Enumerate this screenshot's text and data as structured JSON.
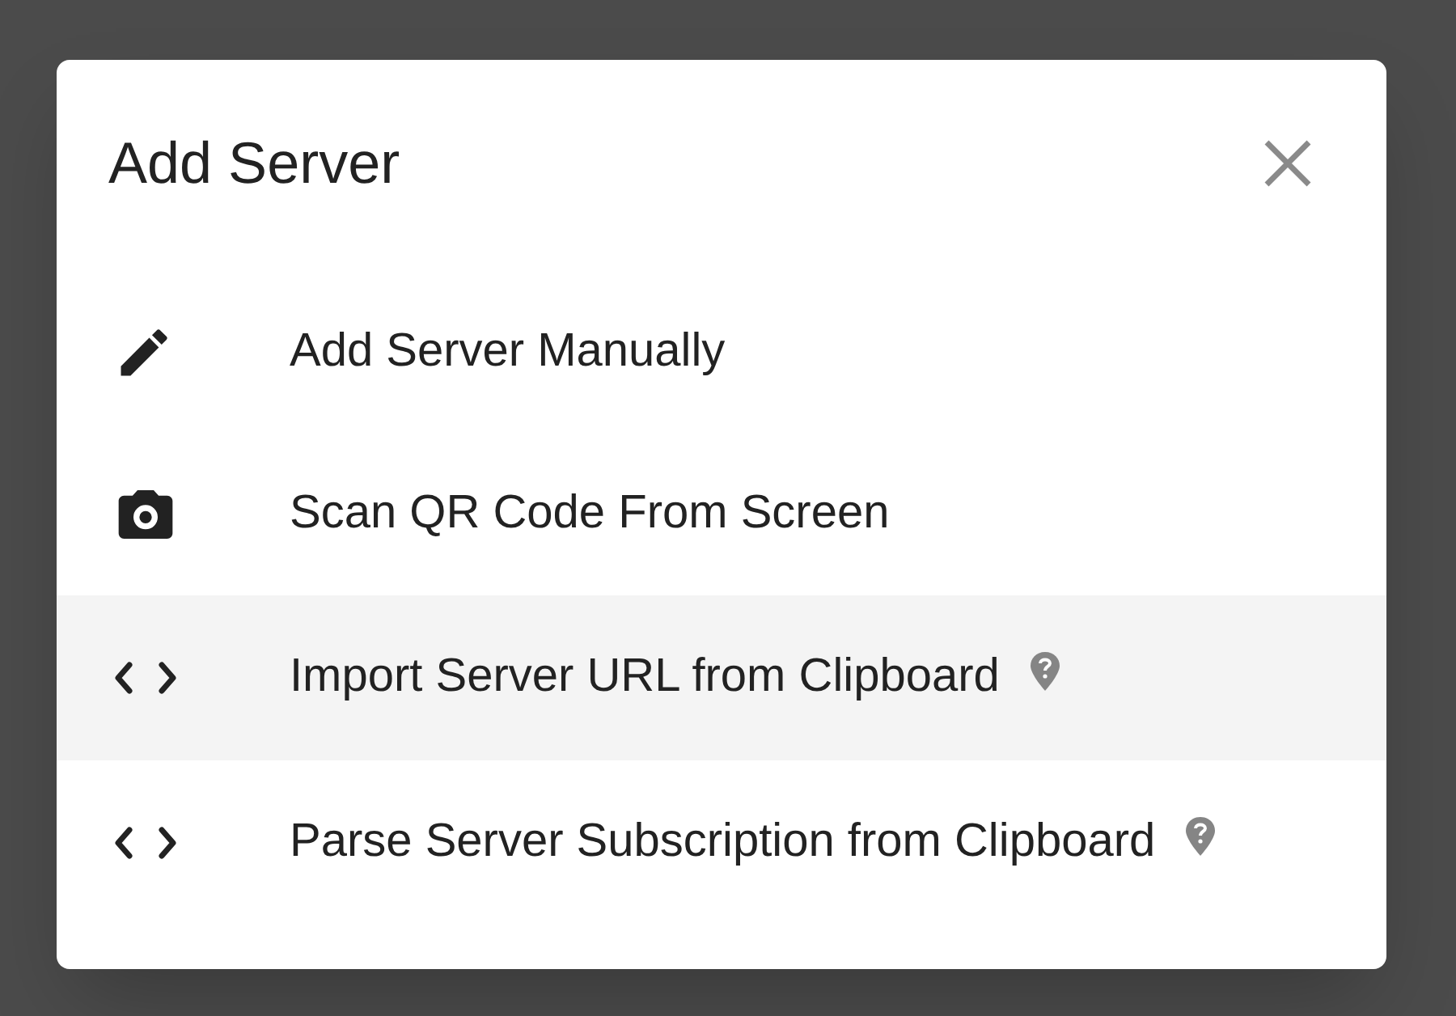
{
  "dialog": {
    "title": "Add Server",
    "items": [
      {
        "kind": "pencil",
        "label": "Add Server Manually",
        "highlighted": false,
        "help": false
      },
      {
        "kind": "camera",
        "label": "Scan QR Code From Screen",
        "highlighted": false,
        "help": false
      },
      {
        "kind": "code",
        "label": "Import Server URL from Clipboard",
        "highlighted": true,
        "help": true
      },
      {
        "kind": "code",
        "label": "Parse Server Subscription from Clipboard",
        "highlighted": false,
        "help": true
      }
    ]
  }
}
